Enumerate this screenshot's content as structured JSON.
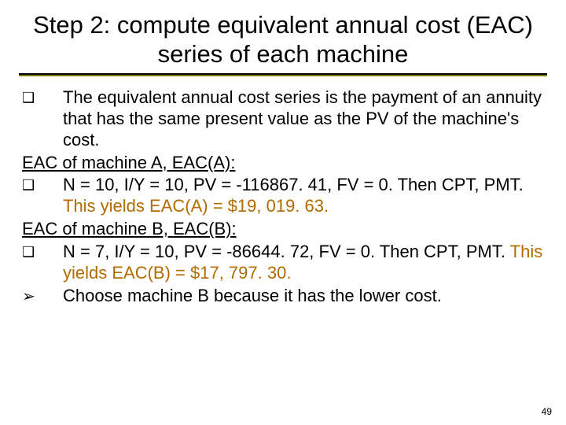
{
  "title": "Step 2: compute equivalent annual cost (EAC) series of each machine",
  "bullets": {
    "b1": "The equivalent annual cost series is the payment of an annuity that has the same present value as the PV of the machine's cost.",
    "headA": "EAC of machine A, EAC(A):",
    "b2_pre": "N = 10, I/Y = 10, PV = -116867. 41, FV = 0. Then CPT, PMT. ",
    "b2_hi": "This yields EAC(A) = $19, 019. 63.",
    "headB": " EAC of machine B, EAC(B):",
    "b3_pre": "N = 7, I/Y = 10, PV = -86644. 72, FV = 0. Then CPT, PMT. ",
    "b3_hi": "This yields EAC(B) = $17, 797. 30.",
    "b4": "Choose machine B because it has the lower cost."
  },
  "glyphs": {
    "square": "❑",
    "arrow": "➢"
  },
  "page_number": "49"
}
